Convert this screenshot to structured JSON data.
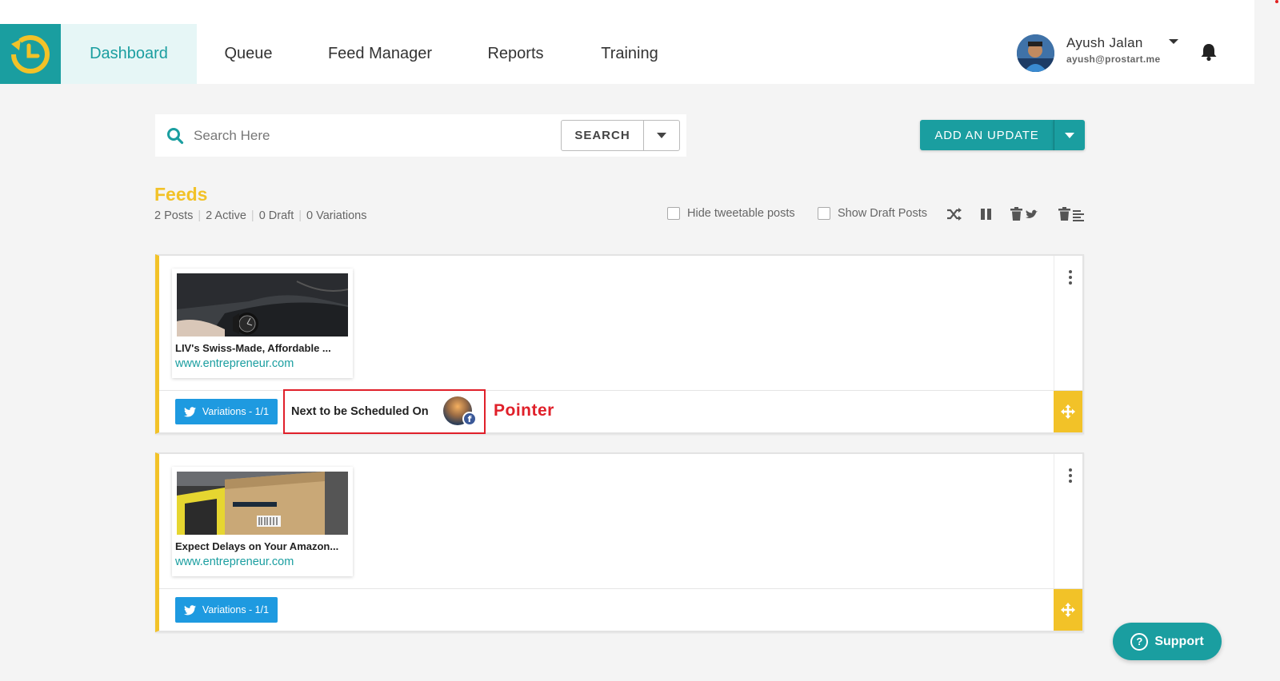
{
  "nav": {
    "items": [
      {
        "label": "Dashboard",
        "active": true
      },
      {
        "label": "Queue"
      },
      {
        "label": "Feed Manager"
      },
      {
        "label": "Reports"
      },
      {
        "label": "Training"
      }
    ]
  },
  "user": {
    "name": "Ayush Jalan",
    "email": "ayush@prostart.me"
  },
  "search": {
    "placeholder": "Search Here",
    "button_label": "SEARCH"
  },
  "add_update": {
    "label": "ADD AN UPDATE"
  },
  "feeds": {
    "title": "Feeds",
    "stats": [
      "2 Posts",
      "2 Active",
      "0 Draft",
      "0 Variations"
    ],
    "options": {
      "hide_tweetable": "Hide tweetable posts",
      "show_draft": "Show Draft Posts"
    }
  },
  "posts": [
    {
      "title": "LIV's Swiss-Made, Affordable ...",
      "link": "www.entrepreneur.com",
      "variations": "Variations - 1/1",
      "next_scheduled": "Next to be Scheduled On",
      "pointer_label": "Pointer"
    },
    {
      "title": "Expect Delays on Your Amazon...",
      "link": "www.entrepreneur.com",
      "variations": "Variations - 1/1"
    }
  ],
  "support": {
    "label": "Support"
  },
  "colors": {
    "accent": "#1a9ea0",
    "feeds_yellow": "#f2c228",
    "twitter_blue": "#1e9ae0",
    "pointer_red": "#e0202a"
  }
}
